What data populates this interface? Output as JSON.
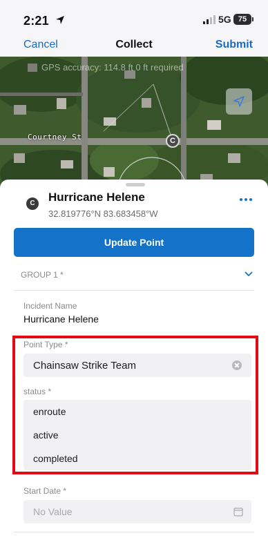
{
  "status_bar": {
    "time": "2:21",
    "network": "5G",
    "battery": "75"
  },
  "nav": {
    "cancel_label": "Cancel",
    "title": "Collect",
    "submit_label": "Submit"
  },
  "map": {
    "gps_text": "GPS accuracy: 114.8 ft    0 ft required",
    "street_label": "Courtney St",
    "pin_letter": "C"
  },
  "feature": {
    "icon_letter": "C",
    "title": "Hurricane Helene",
    "coordinates": "32.819776°N  83.683458°W"
  },
  "update_button_label": "Update Point",
  "group": {
    "label": "GROUP 1 *"
  },
  "fields": {
    "incident_name_label": "Incident Name",
    "incident_name_value": "Hurricane Helene",
    "point_type_label": "Point Type *",
    "point_type_value": "Chainsaw Strike Team",
    "status_label": "status *",
    "status_options": [
      "enroute",
      "active",
      "completed"
    ],
    "start_date_label": "Start Date *",
    "start_date_placeholder": "No Value"
  },
  "colors": {
    "accent": "#1473c8",
    "link": "#1769c8",
    "highlight": "#e50914"
  },
  "icons": [
    "location-arrow-icon",
    "signal-bars-icon",
    "locate-me-icon",
    "more-dots-icon",
    "chevron-down-icon",
    "clear-icon",
    "calendar-icon"
  ]
}
